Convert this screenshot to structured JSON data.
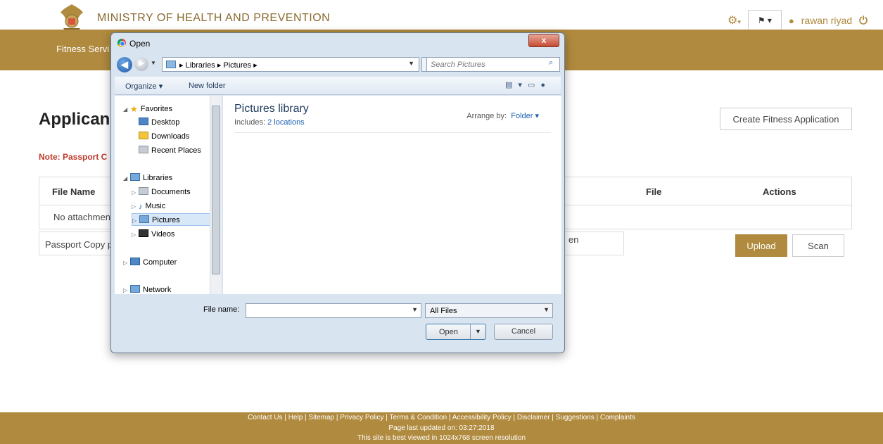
{
  "header": {
    "ministry_title": "MINISTRY OF HEALTH AND PREVENTION",
    "user_name": "rawan riyad",
    "settings_caret": "▾",
    "flag_caret": "▾"
  },
  "nav": {
    "fitness_item": "Fitness Servi"
  },
  "main": {
    "heading": "Applican",
    "note": "Note: Passport C",
    "create_button": "Create Fitness Application",
    "table": {
      "columns": {
        "file_name": "File Name",
        "file": "File",
        "actions": "Actions"
      },
      "empty_text": "No attachment"
    },
    "passport_label": "Passport Copy p",
    "passport_tail": "en",
    "upload_button": "Upload",
    "scan_button": "Scan"
  },
  "footer": {
    "links": "Contact Us | Help | Sitemap | Privacy Policy | Terms & Condition | Accessibility Policy | Disclaimer | Suggestions | Complaints",
    "updated": "Page last updated on: 03:27:2018",
    "resolution": "This site is best viewed in 1024x768 screen resolution"
  },
  "dialog": {
    "title": "Open",
    "close": "x",
    "address": "▸ Libraries ▸ Pictures ▸",
    "search_placeholder": "Search Pictures",
    "organize": "Organize ▾",
    "new_folder": "New folder",
    "nav": {
      "favorites": "Favorites",
      "desktop": "Desktop",
      "downloads": "Downloads",
      "recent_places": "Recent Places",
      "libraries": "Libraries",
      "documents": "Documents",
      "music": "Music",
      "pictures": "Pictures",
      "videos": "Videos",
      "computer": "Computer",
      "network": "Network"
    },
    "library_title": "Pictures library",
    "includes_label": "Includes:",
    "includes_link": "2 locations",
    "arrange_label": "Arrange by:",
    "arrange_value": "Folder ▾",
    "file_name_label": "File name:",
    "file_name_value": "",
    "file_type": "All Files",
    "open_button": "Open",
    "cancel_button": "Cancel"
  }
}
